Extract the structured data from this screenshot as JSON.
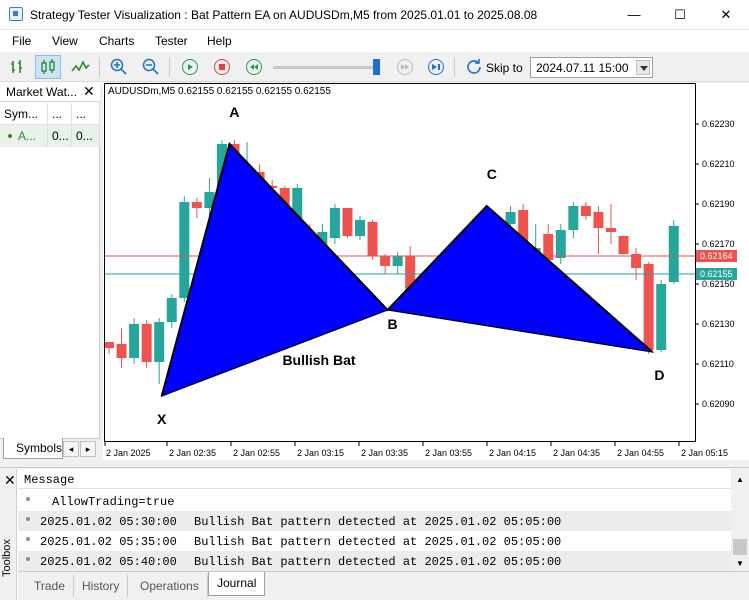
{
  "window": {
    "title": "Strategy Tester Visualization : Bat Pattern EA on AUDUSDm,M5 from 2025.01.01 to 2025.08.08",
    "minimize_glyph": "—",
    "maximize_glyph": "☐",
    "close_glyph": "✕"
  },
  "menu": [
    "File",
    "View",
    "Charts",
    "Tester",
    "Help"
  ],
  "toolbar": {
    "skip_label": "Skip to",
    "skip_value": "2024.07.11 15:00",
    "speed_level": 0.97
  },
  "market_watch": {
    "title": "Market Wat...",
    "close_glyph": "✕",
    "columns": [
      "Sym...",
      "...",
      "..."
    ],
    "rows": [
      [
        "A...",
        "0...",
        "0..."
      ]
    ],
    "tab": "Symbols"
  },
  "chart": {
    "header": "AUDUSDm,M5  0.62155 0.62155 0.62155 0.62155",
    "price_labels": [
      "0.62230",
      "0.62210",
      "0.62190",
      "0.62170",
      "0.62150",
      "0.62130",
      "0.62110",
      "0.62090"
    ],
    "bid_label": "0.62164",
    "ask_label": "0.62155",
    "time_labels": [
      "2 Jan 2025",
      "2 Jan 02:35",
      "2 Jan 02:55",
      "2 Jan 03:15",
      "2 Jan 03:35",
      "2 Jan 03:55",
      "2 Jan 04:15",
      "2 Jan 04:35",
      "2 Jan 04:55",
      "2 Jan 05:15"
    ],
    "pattern_label": "Bullish Bat",
    "points": [
      "X",
      "A",
      "B",
      "C",
      "D"
    ],
    "colors": {
      "bull": "#26a69a",
      "bear": "#ef5350",
      "pattern": "#0000ff",
      "bid_line": "#ef5350",
      "ask_line": "#26a69a"
    }
  },
  "chart_data": {
    "type": "candlestick",
    "symbol": "AUDUSDm",
    "timeframe": "M5",
    "ylim": [
      0.62075,
      0.62245
    ],
    "candles": [
      {
        "o": 0.62121,
        "h": 0.62121,
        "l": 0.62115,
        "c": 0.62118
      },
      {
        "o": 0.6212,
        "h": 0.62128,
        "l": 0.62108,
        "c": 0.62113
      },
      {
        "o": 0.62113,
        "h": 0.62133,
        "l": 0.6211,
        "c": 0.6213
      },
      {
        "o": 0.6213,
        "h": 0.62132,
        "l": 0.62108,
        "c": 0.62111
      },
      {
        "o": 0.62111,
        "h": 0.62133,
        "l": 0.621,
        "c": 0.62131
      },
      {
        "o": 0.62131,
        "h": 0.62145,
        "l": 0.62128,
        "c": 0.62143
      },
      {
        "o": 0.62143,
        "h": 0.62194,
        "l": 0.62141,
        "c": 0.62191
      },
      {
        "o": 0.62191,
        "h": 0.62193,
        "l": 0.62183,
        "c": 0.62188
      },
      {
        "o": 0.62188,
        "h": 0.62203,
        "l": 0.62184,
        "c": 0.62196
      },
      {
        "o": 0.62186,
        "h": 0.62222,
        "l": 0.62184,
        "c": 0.6222
      },
      {
        "o": 0.6222,
        "h": 0.62222,
        "l": 0.62198,
        "c": 0.62202
      },
      {
        "o": 0.62203,
        "h": 0.62221,
        "l": 0.62202,
        "c": 0.62204
      },
      {
        "o": 0.62206,
        "h": 0.6221,
        "l": 0.62198,
        "c": 0.622
      },
      {
        "o": 0.62199,
        "h": 0.62202,
        "l": 0.62195,
        "c": 0.62198
      },
      {
        "o": 0.62198,
        "h": 0.62199,
        "l": 0.62163,
        "c": 0.62165
      },
      {
        "o": 0.62165,
        "h": 0.622,
        "l": 0.6216,
        "c": 0.62198
      },
      {
        "o": 0.62175,
        "h": 0.6218,
        "l": 0.62162,
        "c": 0.62164
      },
      {
        "o": 0.62164,
        "h": 0.6218,
        "l": 0.6216,
        "c": 0.62176
      },
      {
        "o": 0.62173,
        "h": 0.6219,
        "l": 0.6217,
        "c": 0.62188
      },
      {
        "o": 0.62188,
        "h": 0.62188,
        "l": 0.62173,
        "c": 0.62174
      },
      {
        "o": 0.62174,
        "h": 0.62184,
        "l": 0.62172,
        "c": 0.62182
      },
      {
        "o": 0.62181,
        "h": 0.62182,
        "l": 0.62162,
        "c": 0.62164
      },
      {
        "o": 0.62164,
        "h": 0.62165,
        "l": 0.62155,
        "c": 0.62159
      },
      {
        "o": 0.62159,
        "h": 0.62166,
        "l": 0.62155,
        "c": 0.62164
      },
      {
        "o": 0.62164,
        "h": 0.62169,
        "l": 0.62141,
        "c": 0.62144
      },
      {
        "o": 0.62143,
        "h": 0.62148,
        "l": 0.62138,
        "c": 0.62143
      },
      {
        "o": 0.6214,
        "h": 0.62145,
        "l": 0.62136,
        "c": 0.62143
      },
      {
        "o": 0.62143,
        "h": 0.62155,
        "l": 0.6214,
        "c": 0.62154
      },
      {
        "o": 0.62154,
        "h": 0.62158,
        "l": 0.62143,
        "c": 0.62146
      },
      {
        "o": 0.62146,
        "h": 0.62162,
        "l": 0.62143,
        "c": 0.62155
      },
      {
        "o": 0.62146,
        "h": 0.6217,
        "l": 0.62144,
        "c": 0.62168
      },
      {
        "o": 0.62165,
        "h": 0.62183,
        "l": 0.62162,
        "c": 0.6218
      },
      {
        "o": 0.6218,
        "h": 0.62189,
        "l": 0.62178,
        "c": 0.62186
      },
      {
        "o": 0.62187,
        "h": 0.6219,
        "l": 0.62158,
        "c": 0.62162
      },
      {
        "o": 0.62165,
        "h": 0.6218,
        "l": 0.62153,
        "c": 0.62168
      },
      {
        "o": 0.62175,
        "h": 0.6218,
        "l": 0.62158,
        "c": 0.62162
      },
      {
        "o": 0.62163,
        "h": 0.6218,
        "l": 0.6216,
        "c": 0.62177
      },
      {
        "o": 0.62177,
        "h": 0.62191,
        "l": 0.62173,
        "c": 0.62189
      },
      {
        "o": 0.62189,
        "h": 0.62191,
        "l": 0.62182,
        "c": 0.62184
      },
      {
        "o": 0.62186,
        "h": 0.62189,
        "l": 0.62165,
        "c": 0.62178
      },
      {
        "o": 0.62178,
        "h": 0.6219,
        "l": 0.6217,
        "c": 0.62176
      },
      {
        "o": 0.62174,
        "h": 0.62172,
        "l": 0.62168,
        "c": 0.62165
      },
      {
        "o": 0.62165,
        "h": 0.62168,
        "l": 0.62152,
        "c": 0.62158
      },
      {
        "o": 0.6216,
        "h": 0.62161,
        "l": 0.62115,
        "c": 0.62117
      },
      {
        "o": 0.62117,
        "h": 0.62152,
        "l": 0.62116,
        "c": 0.6215
      },
      {
        "o": 0.62151,
        "h": 0.62182,
        "l": 0.6215,
        "c": 0.62179
      }
    ],
    "bid": 0.62164,
    "ask": 0.62155,
    "pattern": {
      "name": "Bullish Bat",
      "X": {
        "i": 4.2,
        "price": 0.62094
      },
      "A": {
        "i": 9.6,
        "price": 0.6222
      },
      "B": {
        "i": 22.2,
        "price": 0.62137
      },
      "C": {
        "i": 30.1,
        "price": 0.62189
      },
      "D": {
        "i": 43.3,
        "price": 0.62116
      }
    }
  },
  "toolbox": {
    "title": "Toolbox",
    "close_glyph": "✕",
    "header": "Message",
    "rows": [
      {
        "time": "",
        "message": "AllowTrading=true"
      },
      {
        "time": "2025.01.02 05:30:00",
        "message": "Bullish Bat pattern detected at 2025.01.02 05:05:00"
      },
      {
        "time": "2025.01.02 05:35:00",
        "message": "Bullish Bat pattern detected at 2025.01.02 05:05:00"
      },
      {
        "time": "2025.01.02 05:40:00",
        "message": "Bullish Bat pattern detected at 2025.01.02 05:05:00"
      }
    ],
    "tabs": [
      "Trade",
      "History",
      "Operations",
      "Journal"
    ],
    "active_tab": "Journal"
  }
}
